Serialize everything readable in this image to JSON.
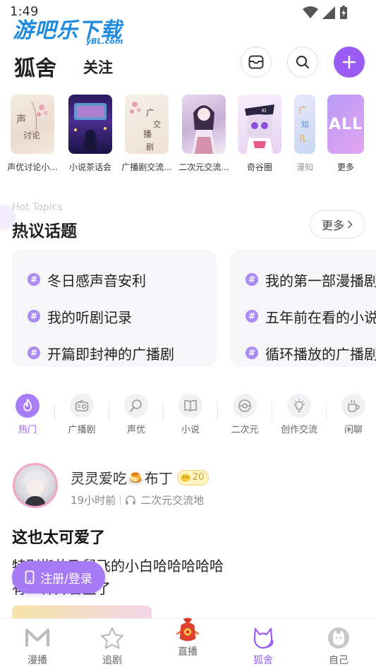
{
  "status_bar": {
    "time": "1:49"
  },
  "watermark": {
    "main": "游吧乐下载",
    "sub": "yBL.com"
  },
  "header": {
    "title": "狐舍",
    "follow_tab": "关注"
  },
  "circles": [
    {
      "label": "声优讨论小..."
    },
    {
      "label": "小说茶话会"
    },
    {
      "label": "广播剧交流..."
    },
    {
      "label": "二次元交流..."
    },
    {
      "label": "奇谷圈"
    },
    {
      "label": "漫知"
    },
    {
      "label": "更多",
      "thumb_text": "ALL"
    }
  ],
  "hot_topics": {
    "title_en": "Hot Topics",
    "title_zh": "热议话题",
    "more_label": "更多",
    "columns": [
      [
        "冬日感声音安利",
        "我的听剧记录",
        "开篇即封神的广播剧"
      ],
      [
        "我的第一部漫播剧",
        "五年前在看的小说",
        "循环播放的广播剧"
      ]
    ]
  },
  "categories": [
    {
      "label": "热门",
      "icon": "flame-icon",
      "active": true
    },
    {
      "label": "广播剧",
      "icon": "radio-icon"
    },
    {
      "label": "声优",
      "icon": "microphone-icon"
    },
    {
      "label": "小说",
      "icon": "book-icon"
    },
    {
      "label": "二次元",
      "icon": "pokeball-icon"
    },
    {
      "label": "创作交流",
      "icon": "lightbulb-icon"
    },
    {
      "label": "闲聊",
      "icon": "coffee-icon"
    }
  ],
  "post": {
    "username": "灵灵爱吃🍮布丁",
    "level": "20",
    "time_ago": "19小时前",
    "circle": "二次元交流地",
    "title": "这也太可爱了",
    "body_line1": "特别指的飞鼠飞的小白哈哈哈哈哈",
    "body_line2": "有一种开盲盒了"
  },
  "login_button": {
    "label": "注册/登录"
  },
  "bottom_nav": [
    {
      "label": "漫播",
      "icon": "manbo-logo-icon"
    },
    {
      "label": "追剧",
      "icon": "star-icon"
    },
    {
      "label": "直播",
      "icon": "live-bag-icon"
    },
    {
      "label": "狐舍",
      "icon": "fox-icon",
      "active": true
    },
    {
      "label": "自己",
      "icon": "profile-icon"
    }
  ],
  "colors": {
    "accent": "#9b5cf6",
    "accent_light": "#a97cf8"
  }
}
